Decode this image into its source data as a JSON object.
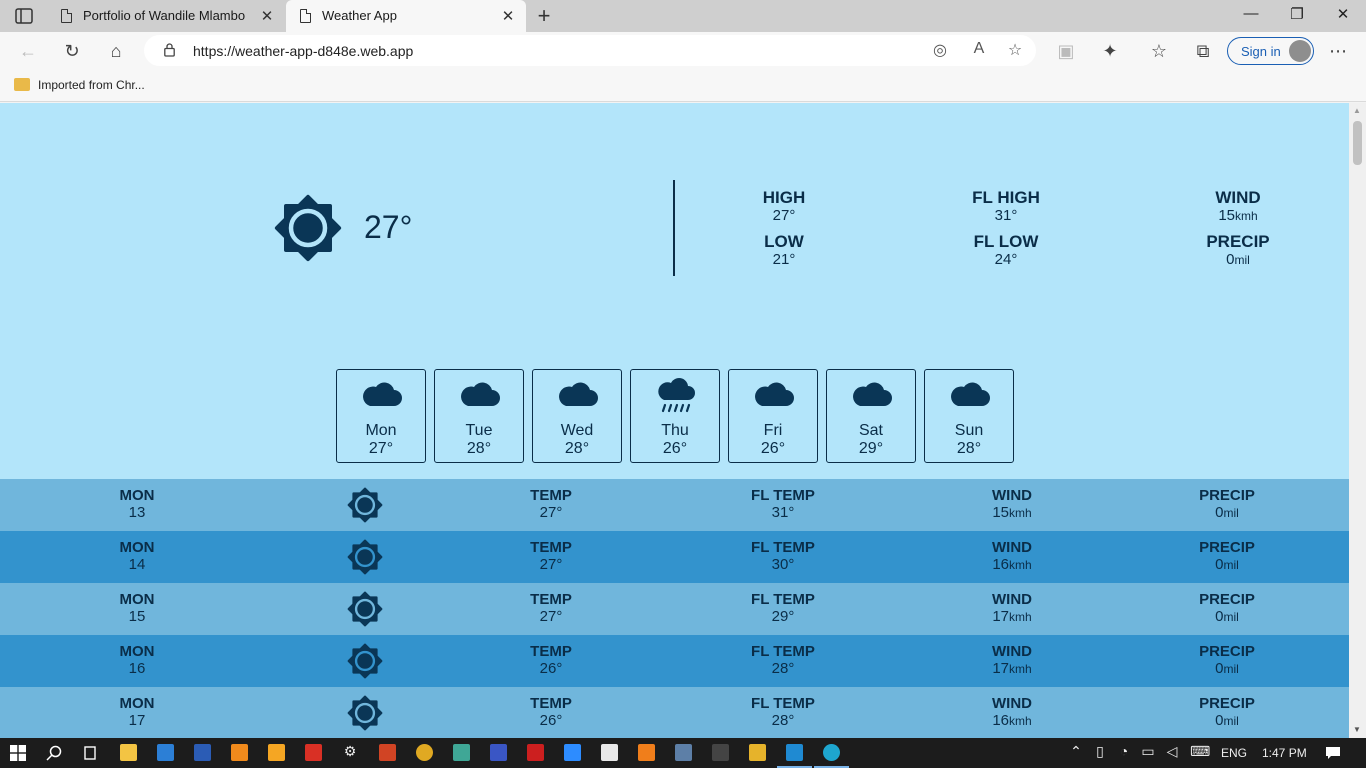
{
  "browser": {
    "tabs": [
      {
        "title": "Portfolio of Wandile Mlambo",
        "close": "✕"
      },
      {
        "title": "Weather App",
        "close": "✕"
      }
    ],
    "new_tab": "+",
    "window_controls": {
      "minimize": "—",
      "restore": "❐",
      "close": "✕"
    },
    "url": "https://weather-app-d848e.web.app",
    "sign_in": "Sign in",
    "favorites": [
      {
        "label": "Imported from Chr..."
      }
    ],
    "icons": {
      "back": "←",
      "refresh": "↻",
      "home": "⌂",
      "location": "◎",
      "read_aloud": "A",
      "add_favorite": "☆",
      "extension": "▣",
      "extensions": "✦",
      "favorites": "☆",
      "collections": "⧉",
      "more": "⋯"
    }
  },
  "current": {
    "temp": "27°",
    "icon": "sun-icon",
    "stats": [
      {
        "label": "HIGH",
        "value": "27°",
        "unit": ""
      },
      {
        "label": "LOW",
        "value": "21°",
        "unit": ""
      },
      {
        "label": "FL HIGH",
        "value": "31°",
        "unit": ""
      },
      {
        "label": "FL LOW",
        "value": "24°",
        "unit": ""
      },
      {
        "label": "WIND",
        "value": "15",
        "unit": "kmh"
      },
      {
        "label": "PRECIP",
        "value": "0",
        "unit": "mil"
      }
    ]
  },
  "daily": [
    {
      "day": "Mon",
      "temp": "27°",
      "icon": "cloud-icon"
    },
    {
      "day": "Tue",
      "temp": "28°",
      "icon": "cloud-icon"
    },
    {
      "day": "Wed",
      "temp": "28°",
      "icon": "cloud-icon"
    },
    {
      "day": "Thu",
      "temp": "26°",
      "icon": "rain-icon"
    },
    {
      "day": "Fri",
      "temp": "26°",
      "icon": "cloud-icon"
    },
    {
      "day": "Sat",
      "temp": "29°",
      "icon": "cloud-icon"
    },
    {
      "day": "Sun",
      "temp": "28°",
      "icon": "cloud-icon"
    }
  ],
  "hourly_labels": {
    "temp": "TEMP",
    "fl_temp": "FL TEMP",
    "wind": "WIND",
    "precip": "PRECIP",
    "wind_unit": "kmh",
    "precip_unit": "mil"
  },
  "hourly": [
    {
      "day": "MON",
      "num": "13",
      "temp": "27°",
      "fl": "31°",
      "wind": "15",
      "precip": "0"
    },
    {
      "day": "MON",
      "num": "14",
      "temp": "27°",
      "fl": "30°",
      "wind": "16",
      "precip": "0"
    },
    {
      "day": "MON",
      "num": "15",
      "temp": "27°",
      "fl": "29°",
      "wind": "17",
      "precip": "0"
    },
    {
      "day": "MON",
      "num": "16",
      "temp": "26°",
      "fl": "28°",
      "wind": "17",
      "precip": "0"
    },
    {
      "day": "MON",
      "num": "17",
      "temp": "26°",
      "fl": "28°",
      "wind": "16",
      "precip": "0"
    }
  ],
  "taskbar": {
    "lang": "ENG",
    "time": "1:47 PM"
  },
  "colors": {
    "page_bg": "#b3e5fa",
    "row_light": "#70b6dc",
    "row_dark": "#3393cd",
    "ink": "#0a2d48"
  }
}
